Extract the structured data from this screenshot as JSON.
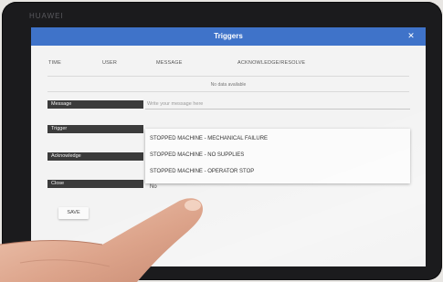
{
  "device": {
    "brand": "HUAWEI"
  },
  "dialog": {
    "title": "Triggers"
  },
  "table": {
    "columns": [
      "TIME",
      "USER",
      "MESSAGE",
      "ACKNOWLEDGE/RESOLVE"
    ],
    "empty_text": "No data available"
  },
  "form": {
    "message_label": "Message",
    "message_placeholder": "Write your message here",
    "trigger_label": "Trigger",
    "acknowledge_label": "Acknowledge",
    "close_label": "Close",
    "close_value_stub": "No",
    "save_label": "SAVE"
  },
  "trigger_menu": {
    "options": [
      "STOPPED MACHINE - MECHANICAL FAILURE",
      "STOPPED MACHINE - NO SUPPLIES",
      "STOPPED MACHINE - OPERATOR STOP"
    ]
  },
  "colors": {
    "app_bar": "#3f73c9",
    "label_bg": "#3b3b3b",
    "bezel": "#1b1b1d"
  }
}
